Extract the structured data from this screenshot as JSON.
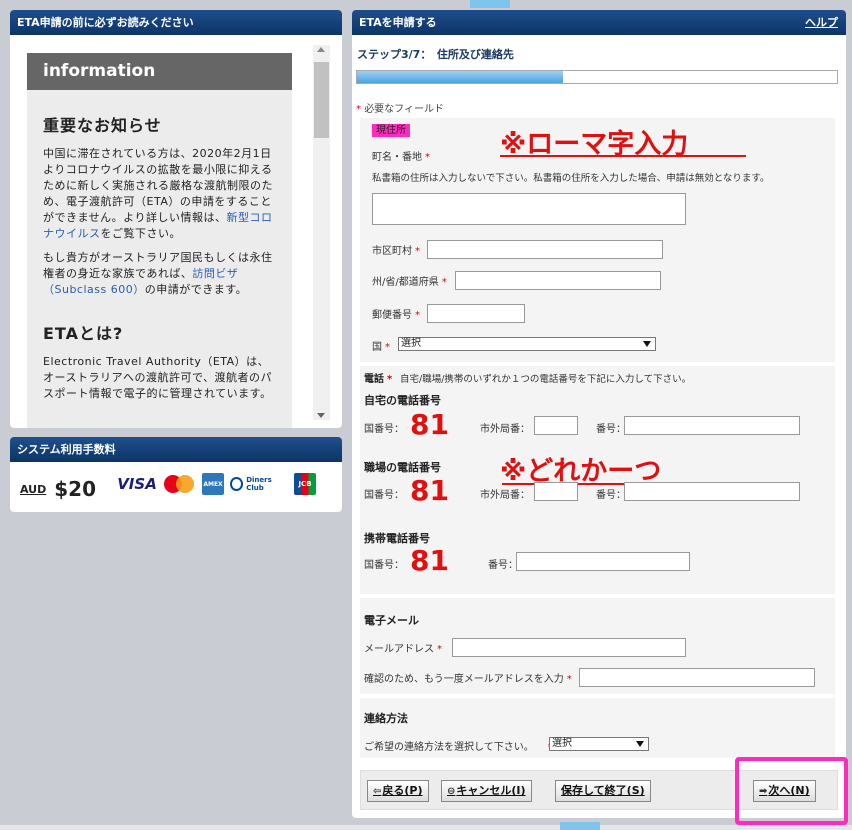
{
  "info_panel": {
    "header": "ETA申請の前に必ずお読みください",
    "card_title": "information",
    "notice_heading": "重要なお知らせ",
    "notice_p1_a": "中国に滞在されている方は、2020年2月1日よりコロナウイルスの拡散を最小限に抑えるために新しく実施される厳格な渡航制限のため、電子渡航許可（ETA）の申請をすることができません。より詳しい情報は、",
    "notice_p1_link": "新型コロナウイルス",
    "notice_p1_b": "をご覧下さい。",
    "notice_p2_a": "もし貴方がオーストラリア国民もしくは永住権者の身近な家族であれば、",
    "notice_p2_link": "訪問ビザ（Subclass 600）",
    "notice_p2_b": "の申請ができます。",
    "eta_heading": "ETAとは?",
    "eta_p": "Electronic Travel Authority（ETA）は、オーストラリアへの渡航許可で、渡航者のパスポート情報で電子的に管理されています。"
  },
  "fee_panel": {
    "header": "システム利用手数料",
    "currency": "AUD",
    "amount": "$20",
    "cards": [
      "VISA",
      "MasterCard",
      "AMEX",
      "Diners Club INTERNATIONAL",
      "JCB"
    ]
  },
  "main_panel": {
    "header": "ETAを申請する",
    "help": "ヘルプ",
    "step": "ステップ3/7：　住所及び連絡先",
    "progress_fraction": 0.43,
    "required_note": "必要なフィールド",
    "address": {
      "title": "現住所",
      "street_label": "町名・番地",
      "street_note": "私書箱の住所は入力しないで下さい。私書箱の住所を入力した場合、申請は無効となります。",
      "city_label": "市区町村",
      "state_label": "州/省/都道府県",
      "postal_label": "郵便番号",
      "country_label": "国",
      "country_value": "選択"
    },
    "phone": {
      "title": "電話",
      "instruction": "自宅/職場/携帯のいずれか１つの電話番号を下記に入力して下さい。",
      "home_title": "自宅の電話番号",
      "work_title": "職場の電話番号",
      "mobile_title": "携帯電話番号",
      "country_code_label": "国番号：",
      "area_code_label": "市外局番：",
      "number_label": "番号："
    },
    "email": {
      "title": "電子メール",
      "address_label": "メールアドレス",
      "confirm_label": "確認のため、もう一度メールアドレスを入力"
    },
    "contact": {
      "title": "連絡方法",
      "instruction": "ご希望の連絡方法を選択して下さい。",
      "value": "選択"
    },
    "buttons": {
      "back": "戻る(P)",
      "cancel": "キャンセル(I)",
      "save": "保存して終了(S)",
      "next": "次へ(N)"
    }
  },
  "annotations": {
    "romaji": "※ローマ字入力",
    "either_one": "※どれかーつ",
    "code": "81"
  },
  "colors": {
    "header_blue": "#0d3466",
    "annotation_red": "#e01010",
    "highlight_pink": "#ff2bbd"
  }
}
